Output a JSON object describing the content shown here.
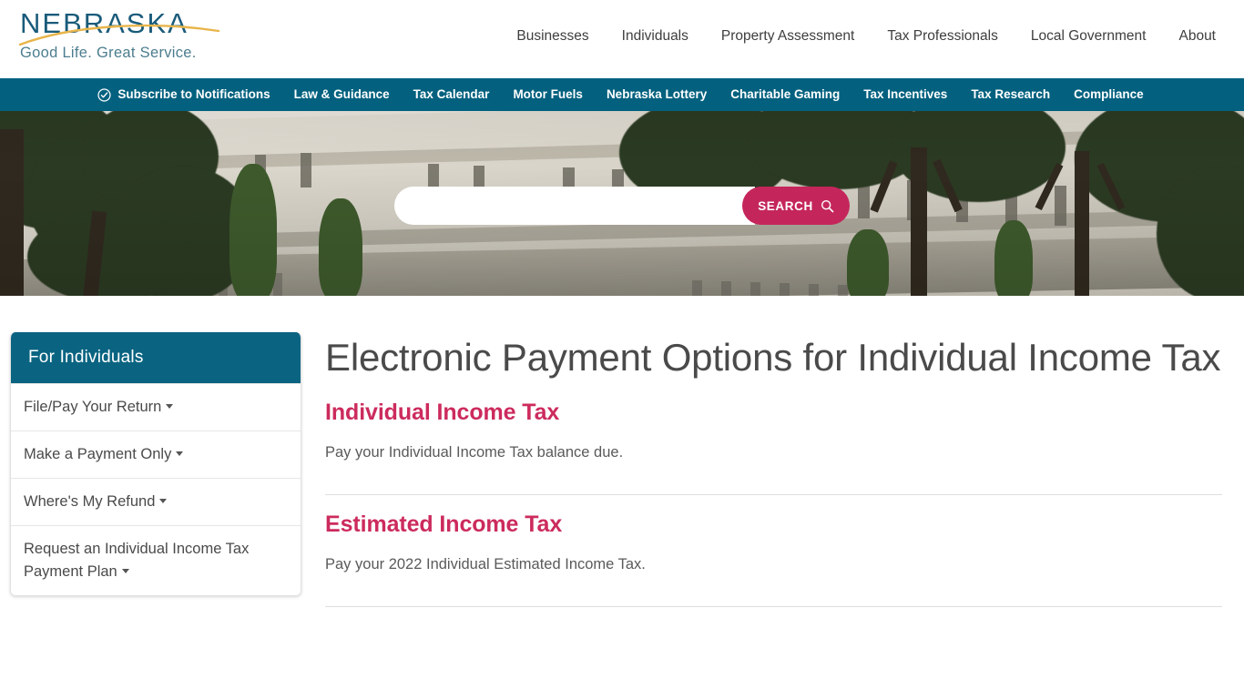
{
  "brand": {
    "wordmark": "NEBRASKA",
    "tagline": "Good Life. Great Service.",
    "swoosh_color": "#e8b54b",
    "wordmark_color": "#1a5b7a"
  },
  "colors": {
    "teal_nav": "#03617f",
    "sidebar_header": "#0a6481",
    "crimson": "#cc2b5d",
    "search_button": "#c4265b"
  },
  "top_nav": {
    "items": [
      {
        "label": "Businesses"
      },
      {
        "label": "Individuals"
      },
      {
        "label": "Property Assessment"
      },
      {
        "label": "Tax Professionals"
      },
      {
        "label": "Local Government"
      },
      {
        "label": "About"
      }
    ]
  },
  "teal_nav": {
    "items": [
      {
        "label": "Subscribe to Notifications",
        "icon": "check-circle-icon"
      },
      {
        "label": "Law & Guidance"
      },
      {
        "label": "Tax Calendar"
      },
      {
        "label": "Motor Fuels"
      },
      {
        "label": "Nebraska Lottery"
      },
      {
        "label": "Charitable Gaming"
      },
      {
        "label": "Tax Incentives"
      },
      {
        "label": "Tax Research"
      },
      {
        "label": "Compliance"
      }
    ]
  },
  "hero": {
    "search": {
      "value": "",
      "placeholder": "",
      "button_label": "SEARCH",
      "button_icon": "magnifier-icon"
    }
  },
  "sidebar": {
    "title": "For Individuals",
    "items": [
      {
        "label": "File/Pay Your Return",
        "has_caret": true
      },
      {
        "label": "Make a Payment Only",
        "has_caret": true
      },
      {
        "label": "Where's My Refund",
        "has_caret": true
      },
      {
        "label": "Request an Individual Income Tax Payment Plan",
        "has_caret": true
      }
    ]
  },
  "main": {
    "title": "Electronic Payment Options for Individual Income Tax",
    "sections": [
      {
        "link_label": "Individual Income Tax",
        "description": "Pay your Individual Income Tax balance due."
      },
      {
        "link_label": "Estimated Income Tax",
        "description": "Pay your 2022 Individual Estimated Income Tax."
      }
    ]
  }
}
